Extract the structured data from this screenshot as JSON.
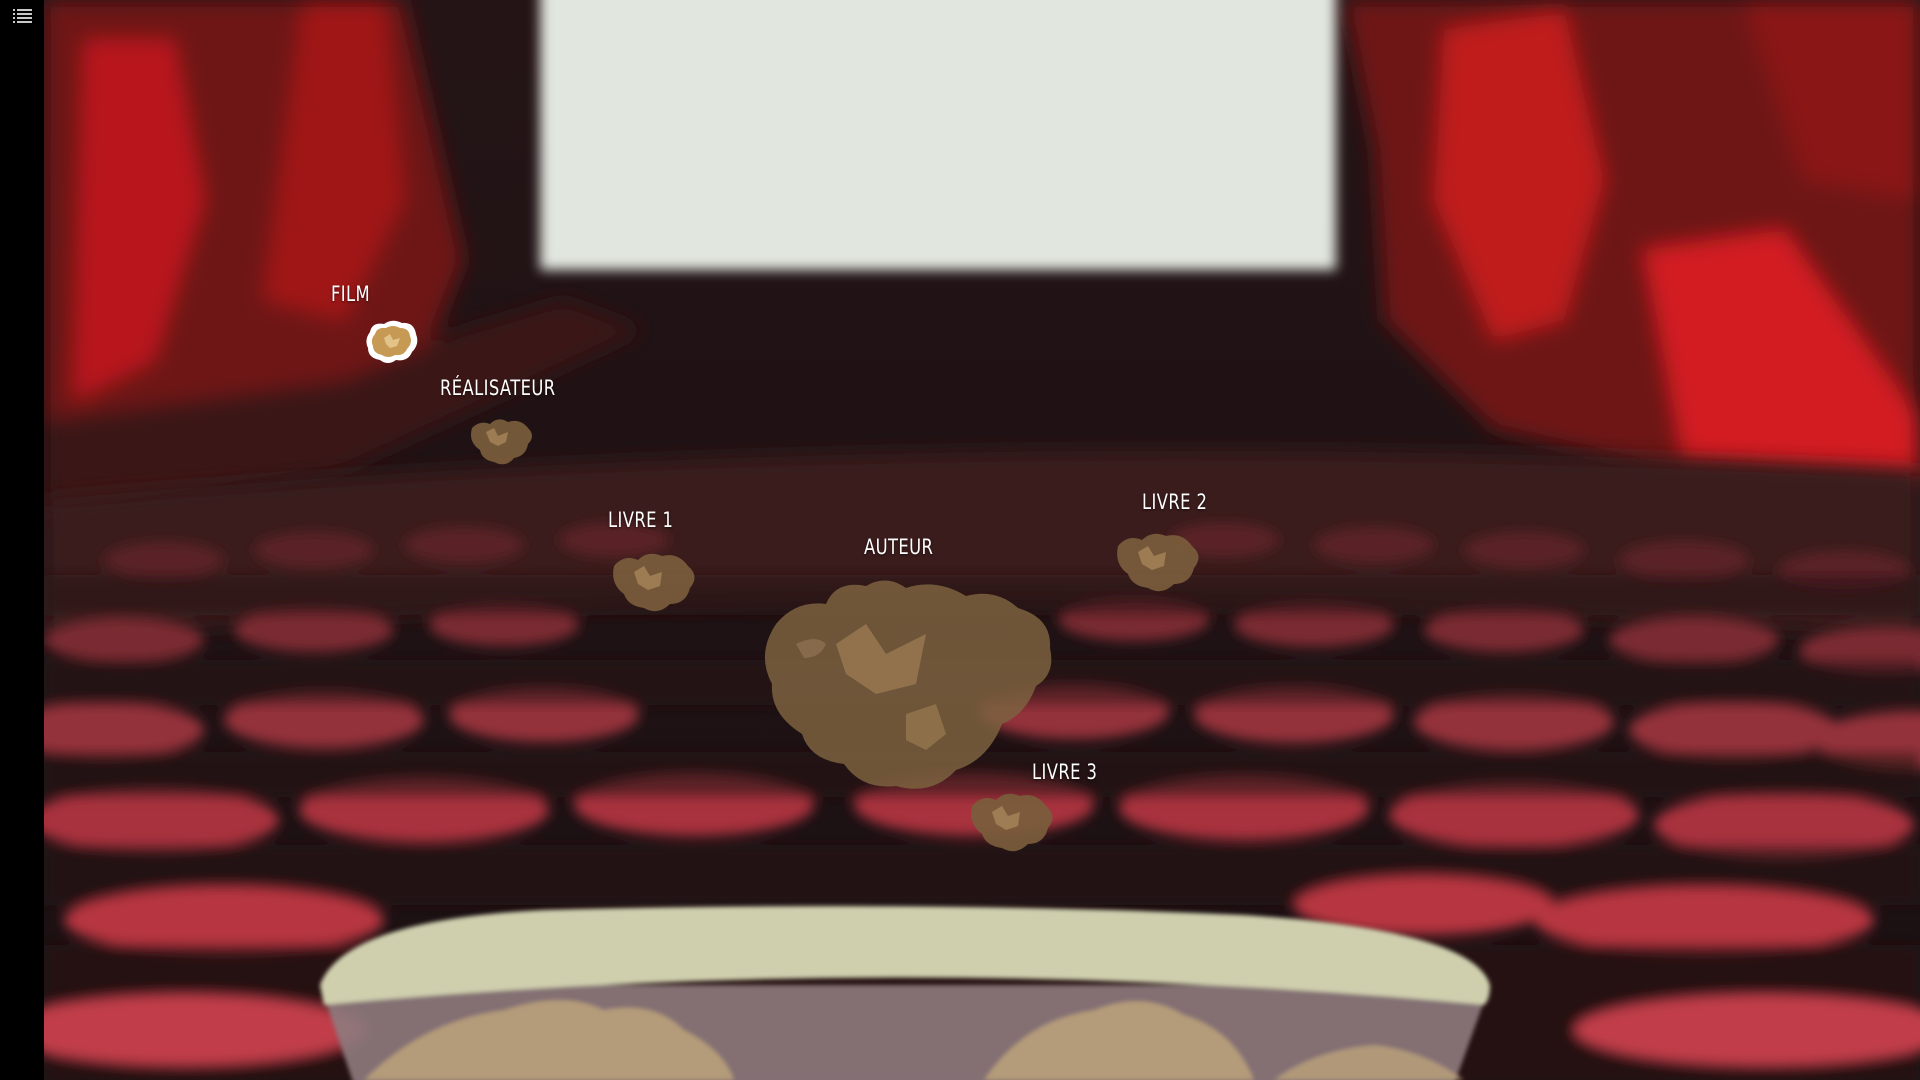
{
  "nodes": [
    {
      "id": "film",
      "label": "FILM",
      "active": true
    },
    {
      "id": "realisateur",
      "label": "RÉALISATEUR",
      "active": false
    },
    {
      "id": "livre1",
      "label": "LIVRE 1",
      "active": false
    },
    {
      "id": "auteur",
      "label": "AUTEUR",
      "active": false
    },
    {
      "id": "livre2",
      "label": "LIVRE 2",
      "active": false
    },
    {
      "id": "livre3",
      "label": "LIVRE 3",
      "active": false
    }
  ],
  "icons": {
    "menu": "list-menu-icon",
    "node": "popcorn-kernel-icon",
    "bucket": "popcorn-bucket-icon"
  },
  "colors": {
    "screen": "#e1e6df",
    "seats": "#a8242c",
    "curtain": "#b01a1c",
    "popcorn": "#8a6a42",
    "popcorn_active": "#c69a55",
    "bucket_rim": "#cfcfae"
  }
}
